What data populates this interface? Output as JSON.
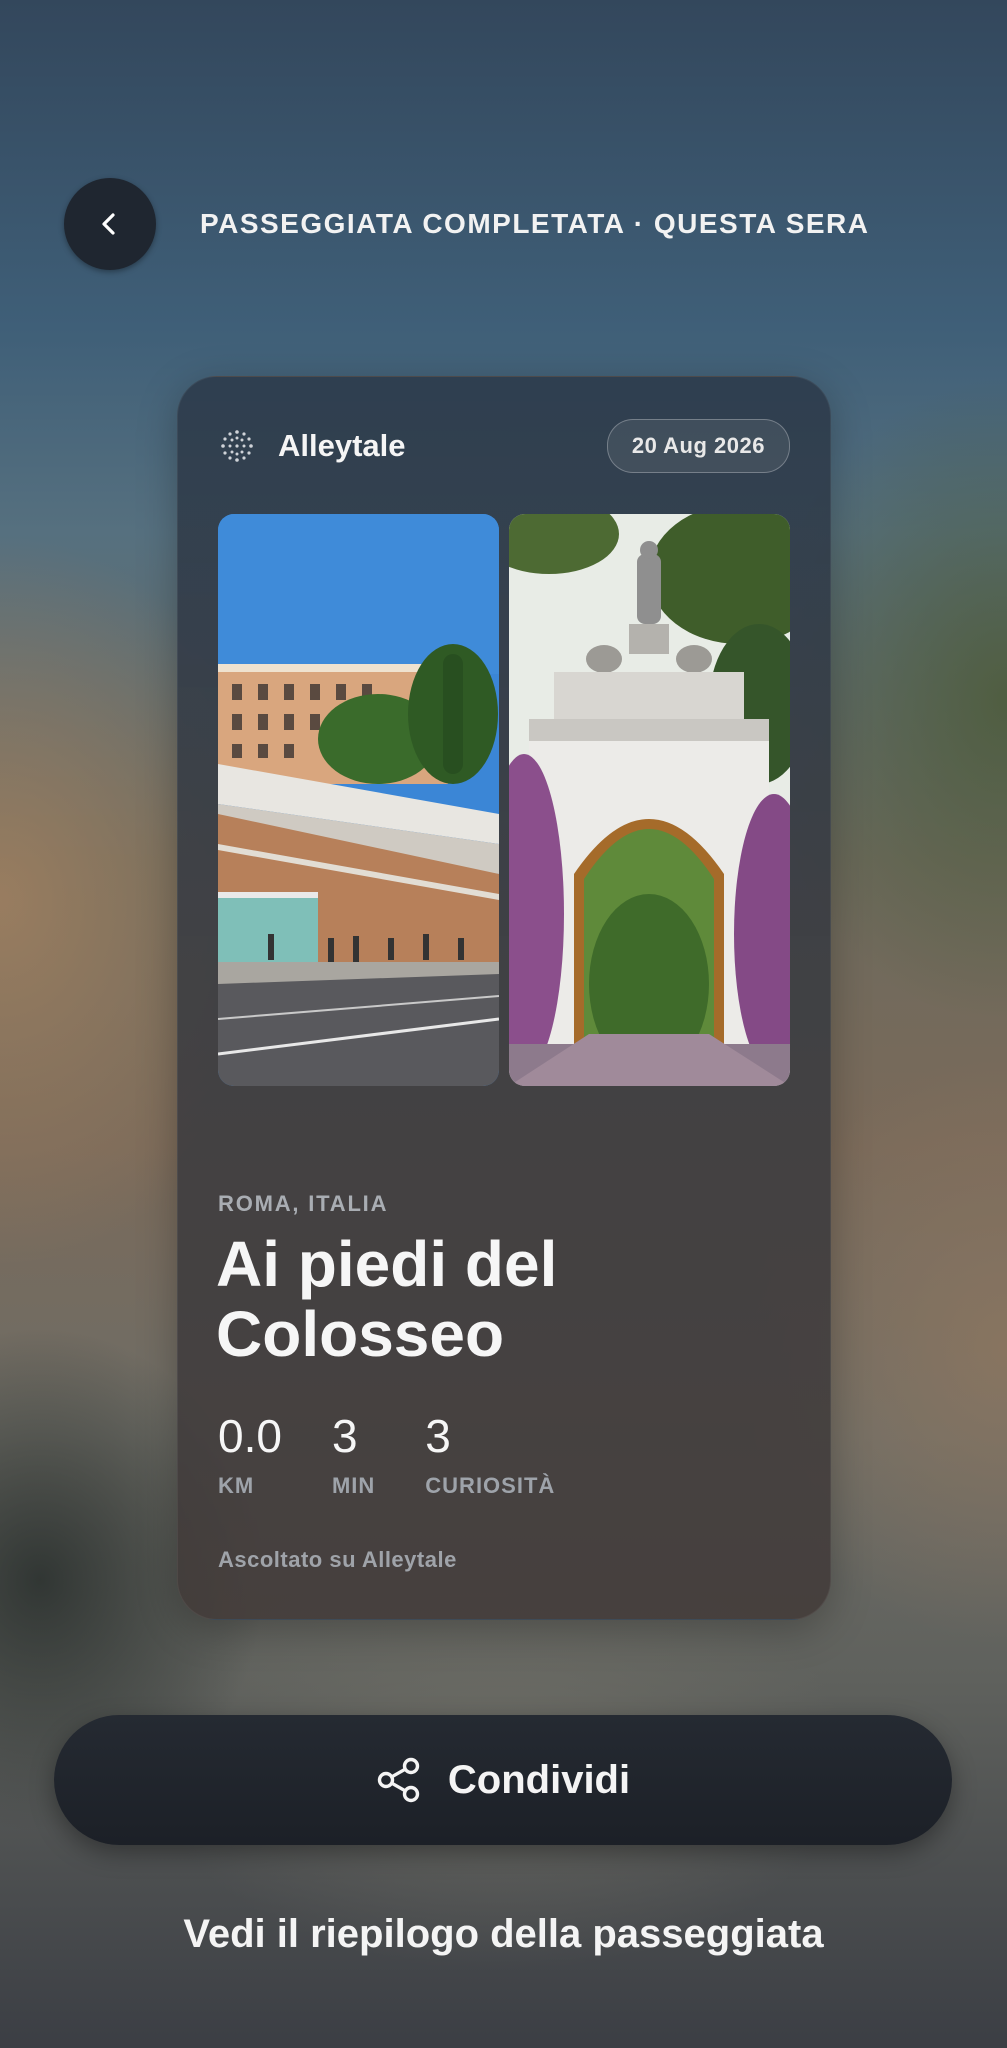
{
  "header": {
    "back_icon": "chevron-left-icon",
    "title": "PASSEGGIATA COMPLETATA · QUESTA SERA"
  },
  "card": {
    "brand": {
      "logo_icon": "dotted-sphere-icon",
      "name": "Alleytale"
    },
    "date": "20 Aug 2026",
    "photos": [
      {
        "subject": "street-buildings"
      },
      {
        "subject": "garden-arch-statue"
      }
    ],
    "location": "ROMA, ITALIA",
    "title": "Ai piedi del Colosseo",
    "stats": [
      {
        "value": "0.0",
        "label": "KM"
      },
      {
        "value": "3",
        "label": "MIN"
      },
      {
        "value": "3",
        "label": "CURIOSITÀ"
      }
    ],
    "footer_note": "Ascoltato su Alleytale"
  },
  "share_button": {
    "icon": "share-icon",
    "label": "Condividi"
  },
  "summary_link": "Vedi il riepilogo della passeggiata",
  "colors": {
    "button_dark": "#1f2630",
    "text_primary": "#f4f4f4",
    "text_muted": "#9ea3aa"
  }
}
